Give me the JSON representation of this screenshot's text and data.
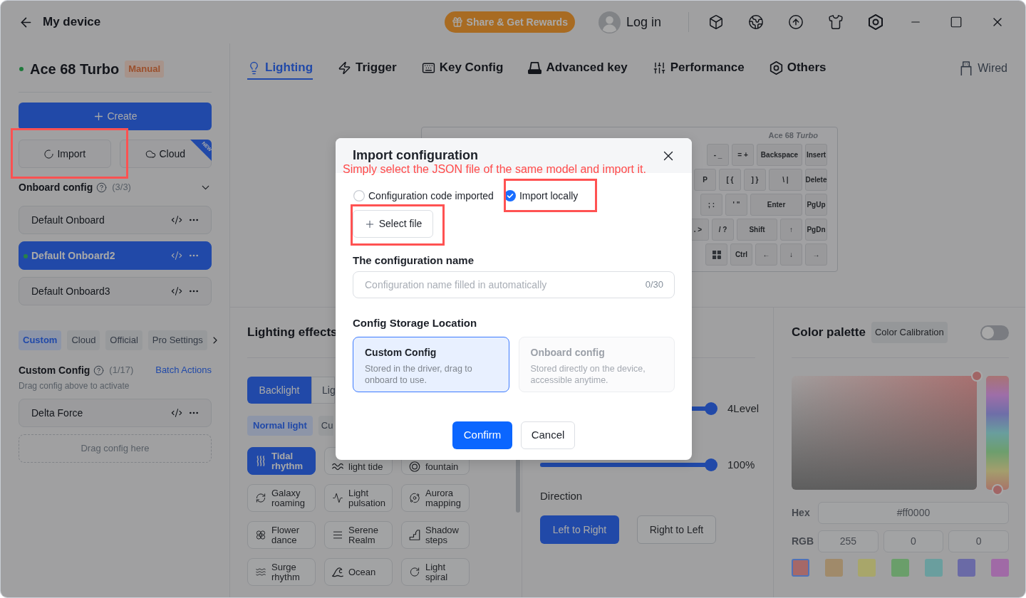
{
  "title_bar": {
    "title": "My device",
    "rewards_button": "Share & Get Rewards",
    "login": "Log in"
  },
  "sidebar": {
    "device": {
      "name": "Ace 68 Turbo",
      "mode": "Manual"
    },
    "create_button": "Create",
    "import_button": "Import",
    "cloud_button": "Cloud",
    "cloud_badge": "NEW",
    "onboard": {
      "title": "Onboard config",
      "count": "(3/3)",
      "expanded": true,
      "items": [
        {
          "name": "Default Onboard",
          "selected": false
        },
        {
          "name": "Default Onboard2",
          "selected": true
        },
        {
          "name": "Default Onboard3",
          "selected": false
        }
      ]
    },
    "tabs": [
      {
        "label": "Custom",
        "selected": true
      },
      {
        "label": "Cloud",
        "selected": false
      },
      {
        "label": "Official",
        "selected": false
      },
      {
        "label": "Pro Settings",
        "selected": false
      }
    ],
    "custom": {
      "title": "Custom Config",
      "count": "(1/17)",
      "action": "Batch Actions",
      "hint": "Drag config above to activate",
      "items": [
        {
          "name": "Delta Force",
          "selected": false
        }
      ],
      "drop_zone": "Drag config here"
    }
  },
  "nav_tabs": [
    {
      "label": "Lighting",
      "selected": true
    },
    {
      "label": "Trigger",
      "selected": false
    },
    {
      "label": "Key Config",
      "selected": false
    },
    {
      "label": "Advanced key",
      "selected": false
    },
    {
      "label": "Performance",
      "selected": false
    },
    {
      "label": "Others",
      "selected": false
    }
  ],
  "connection": "Wired",
  "keyboard": {
    "label": "Ace 68 *Turbo*",
    "rows": [
      [
        "- _",
        "= +",
        "Backspace",
        "Insert"
      ],
      [
        "P",
        "[ {",
        "] }",
        "\\ |",
        "Delete"
      ],
      [
        "; :",
        "' \"",
        "Enter",
        "PgUp"
      ],
      [
        ". >",
        "/ ?",
        "Shift",
        "↑",
        "PgDn"
      ],
      [
        "Ctrl",
        "←",
        "↓",
        "→"
      ]
    ]
  },
  "lighting": {
    "title": "Lighting effects",
    "modes": [
      {
        "label": "Backlight",
        "selected": true
      },
      {
        "label": "Lig",
        "selected": false
      }
    ],
    "categories": [
      {
        "label": "Normal light",
        "selected": true
      },
      {
        "label": "Cu",
        "selected": false
      }
    ],
    "effects": [
      {
        "label": "Tidal rhythm",
        "kind": "full",
        "selected": true
      },
      {
        "label": "light tide",
        "kind": "clipped",
        "selected": false
      },
      {
        "label": "fountain",
        "kind": "clipped",
        "selected": false
      },
      {
        "label": "Galaxy roaming",
        "kind": "full",
        "selected": false
      },
      {
        "label": "Light pulsation",
        "kind": "full",
        "selected": false
      },
      {
        "label": "Aurora mapping",
        "kind": "full",
        "selected": false
      },
      {
        "label": "Flower dance",
        "kind": "full",
        "selected": false
      },
      {
        "label": "Serene Realm",
        "kind": "full",
        "selected": false
      },
      {
        "label": "Shadow steps",
        "kind": "full",
        "selected": false
      },
      {
        "label": "Surge rhythm",
        "kind": "full",
        "selected": false
      },
      {
        "label": "Ocean",
        "kind": "full",
        "selected": false
      },
      {
        "label": "Light spiral",
        "kind": "full",
        "selected": false
      }
    ]
  },
  "effect_settings": {
    "sliders": [
      {
        "level": 1,
        "reading": "4Level"
      },
      {
        "level": 1,
        "reading": "100%"
      }
    ],
    "direction_label": "Direction",
    "directions": [
      {
        "label": "Left to Right",
        "selected": true
      },
      {
        "label": "Right to Left",
        "selected": false
      }
    ]
  },
  "color_palette": {
    "title": "Color palette",
    "calibration": "Color Calibration",
    "calibration_on": false,
    "hex_label": "Hex",
    "hex": "#ff0000",
    "rgb_label": "RGB",
    "rgb": [
      "255",
      "0",
      "0"
    ],
    "swatches": [
      {
        "color": "#a56868",
        "selected": true
      },
      {
        "color": "#a08a6a",
        "selected": false
      },
      {
        "color": "#a8a66a",
        "selected": false
      },
      {
        "color": "#6a9e6a",
        "selected": false
      },
      {
        "color": "#6a9e9e",
        "selected": false
      },
      {
        "color": "#6a6aa6",
        "selected": false
      },
      {
        "color": "#a06aa6",
        "selected": false
      }
    ]
  },
  "dialog": {
    "title": "Import configuration",
    "sources": [
      {
        "label": "Configuration code imported",
        "selected": false
      },
      {
        "label": "Import locally",
        "selected": true
      }
    ],
    "select_file": "Select file",
    "name_label": "The configuration name",
    "name_field": {
      "placeholder": "Configuration name filled in automatically",
      "counter": "0/30"
    },
    "storage_label": "Config Storage Location",
    "storage": [
      {
        "title": "Custom Config",
        "description": "Stored in the driver, drag to onboard to use.",
        "selected": true,
        "disabled": false
      },
      {
        "title": "Onboard config",
        "description": "Stored directly on the device, accessible anytime.",
        "selected": false,
        "disabled": true
      }
    ],
    "confirm": "Confirm",
    "cancel": "Cancel"
  },
  "annotation": {
    "note": "Simply select the JSON file of the same model and import it."
  }
}
